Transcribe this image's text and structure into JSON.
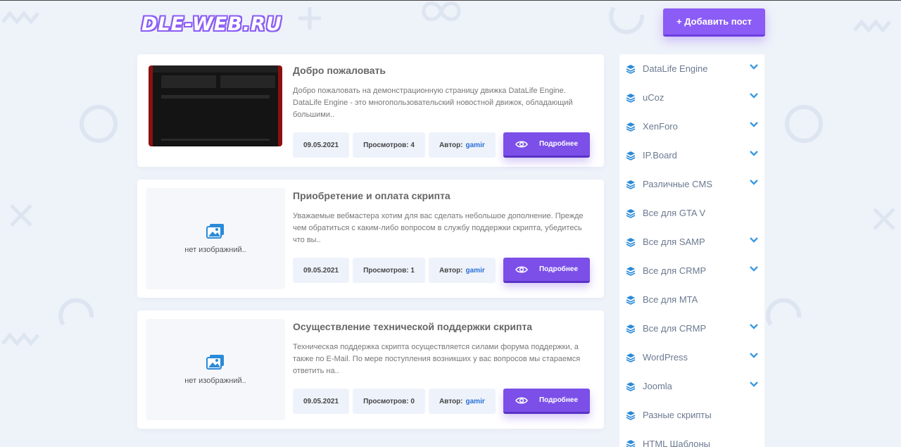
{
  "header": {
    "logo": "DLE-WEB.RU",
    "add_post_label": "+ Добавить пост"
  },
  "posts": [
    {
      "title": "Добро пожаловать",
      "text": "Добро пожаловать на демонстрационную страницу движка DataLife Engine. DataLife Engine - это многопользовательский новостной движок, обладающий большими..",
      "has_image": true,
      "date": "09.05.2021",
      "views": "Просмотров: 4",
      "author_label": "Автор:",
      "author": "gamir",
      "more_label": "Подробнее"
    },
    {
      "title": "Приобретение и оплата скрипта",
      "text": "Уважаемые вебмастера хотим для вас сделать небольшое дополнение. Прежде чем обратиться с каким-либо вопросом в службу поддержки скрипта, убедитесь что вы..",
      "has_image": false,
      "no_image_label": "нет изображний..",
      "date": "09.05.2021",
      "views": "Просмотров: 1",
      "author_label": "Автор:",
      "author": "gamir",
      "more_label": "Подробнее"
    },
    {
      "title": "Осуществление технической поддержки скрипта",
      "text": "Техническая поддержка скрипта осуществляется силами форума поддержки, а также по E-Mail. По мере поступления возникших у вас вопросов мы стараемся ответить на..",
      "has_image": false,
      "no_image_label": "нет изображний..",
      "date": "09.05.2021",
      "views": "Просмотров: 0",
      "author_label": "Автор:",
      "author": "gamir",
      "more_label": "Подробнее"
    }
  ],
  "sidebar": {
    "items": [
      {
        "label": "DataLife Engine",
        "expandable": true
      },
      {
        "label": "uCoz",
        "expandable": true
      },
      {
        "label": "XenForo",
        "expandable": true
      },
      {
        "label": "IP.Board",
        "expandable": true
      },
      {
        "label": "Различные CMS",
        "expandable": true
      },
      {
        "label": "Все для GTA V",
        "expandable": false
      },
      {
        "label": "Все для SAMP",
        "expandable": true
      },
      {
        "label": "Все для CRMP",
        "expandable": true
      },
      {
        "label": "Все для MTA",
        "expandable": false
      },
      {
        "label": "Все для CRMP",
        "expandable": true
      },
      {
        "label": "WordPress",
        "expandable": true
      },
      {
        "label": "Joomla",
        "expandable": true
      },
      {
        "label": "Разные скрипты",
        "expandable": false
      },
      {
        "label": "HTML Шаблоны",
        "expandable": false
      }
    ]
  },
  "colors": {
    "accent": "#8b5cf6",
    "icon_blue": "#2a8ad8",
    "chevron": "#3b9ae1",
    "background": "#eef2f9"
  },
  "icons": {
    "layers": "layers-icon",
    "chevron": "chevron-down-icon",
    "eye": "eye-icon",
    "no_image": "image-icon"
  }
}
